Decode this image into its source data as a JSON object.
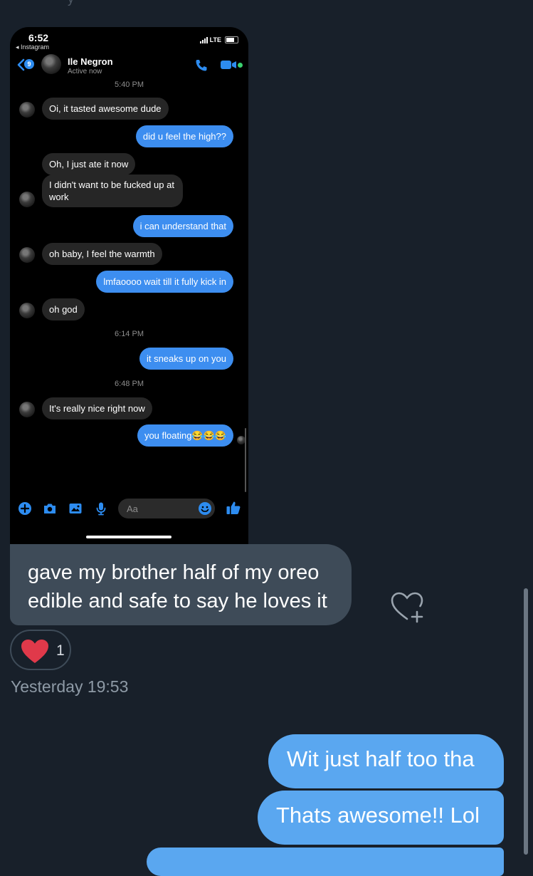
{
  "screenshot": {
    "status": {
      "time": "6:52",
      "back_app": "◂ Instagram",
      "network": "LTE"
    },
    "header": {
      "unread_count": "9",
      "contact_name": "Ile Negron",
      "presence": "Active now"
    },
    "timestamps": [
      "5:40 PM",
      "6:14 PM",
      "6:48 PM"
    ],
    "messages": [
      {
        "dir": "in",
        "text": "Oi, it tasted awesome dude"
      },
      {
        "dir": "out",
        "text": "did u feel the high??"
      },
      {
        "dir": "in",
        "text": "Oh, I just ate it now"
      },
      {
        "dir": "in",
        "text": "I didn't want to be fucked up at work"
      },
      {
        "dir": "out",
        "text": "i can understand that"
      },
      {
        "dir": "in",
        "text": "oh baby, I feel the warmth"
      },
      {
        "dir": "out",
        "text": "lmfaoooo wait till it fully kick in"
      },
      {
        "dir": "in",
        "text": "oh god"
      },
      {
        "dir": "out",
        "text": "it sneaks up on you"
      },
      {
        "dir": "in",
        "text": "It's really nice right now"
      },
      {
        "dir": "out",
        "text": "you floating😂😂😂"
      }
    ],
    "composer": {
      "placeholder": "Aa"
    }
  },
  "conversation": {
    "incoming_message": "gave my brother half of my oreo edible and safe to say he loves it",
    "reaction": {
      "emoji": "heart",
      "count": "1"
    },
    "timestamp": "Yesterday 19:53",
    "outgoing": [
      "Wit just half too tha",
      "Thats awesome!! Lol",
      ""
    ]
  },
  "colors": {
    "background": "#18202a",
    "incoming_bubble": "#3e4b58",
    "outgoing_bubble": "#5aa7f0",
    "messenger_blue": "#3d8ef0",
    "heart": "#e0394a"
  },
  "icons": [
    "back-chevron-icon",
    "phone-icon",
    "video-camera-icon",
    "plus-icon",
    "camera-icon",
    "gallery-icon",
    "microphone-icon",
    "emoji-icon",
    "thumbs-up-icon",
    "heart-add-icon",
    "heart-icon"
  ]
}
